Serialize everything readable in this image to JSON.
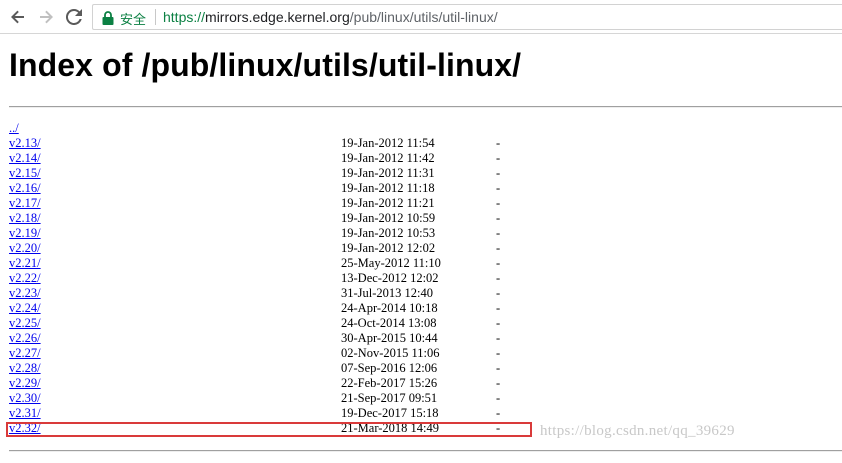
{
  "browser": {
    "security_label": "安全",
    "url_scheme": "https://",
    "url_host": "mirrors.edge.kernel.org",
    "url_path": "/pub/linux/utils/util-linux/"
  },
  "page": {
    "title": "Index of /pub/linux/utils/util-linux/"
  },
  "listing": {
    "parent": "../",
    "entries": [
      {
        "name": "v2.13/",
        "date": "19-Jan-2012 11:54",
        "size": "-"
      },
      {
        "name": "v2.14/",
        "date": "19-Jan-2012 11:42",
        "size": "-"
      },
      {
        "name": "v2.15/",
        "date": "19-Jan-2012 11:31",
        "size": "-"
      },
      {
        "name": "v2.16/",
        "date": "19-Jan-2012 11:18",
        "size": "-"
      },
      {
        "name": "v2.17/",
        "date": "19-Jan-2012 11:21",
        "size": "-"
      },
      {
        "name": "v2.18/",
        "date": "19-Jan-2012 10:59",
        "size": "-"
      },
      {
        "name": "v2.19/",
        "date": "19-Jan-2012 10:53",
        "size": "-"
      },
      {
        "name": "v2.20/",
        "date": "19-Jan-2012 12:02",
        "size": "-"
      },
      {
        "name": "v2.21/",
        "date": "25-May-2012 11:10",
        "size": "-"
      },
      {
        "name": "v2.22/",
        "date": "13-Dec-2012 12:02",
        "size": "-"
      },
      {
        "name": "v2.23/",
        "date": "31-Jul-2013 12:40",
        "size": "-"
      },
      {
        "name": "v2.24/",
        "date": "24-Apr-2014 10:18",
        "size": "-"
      },
      {
        "name": "v2.25/",
        "date": "24-Oct-2014 13:08",
        "size": "-"
      },
      {
        "name": "v2.26/",
        "date": "30-Apr-2015 10:44",
        "size": "-"
      },
      {
        "name": "v2.27/",
        "date": "02-Nov-2015 11:06",
        "size": "-"
      },
      {
        "name": "v2.28/",
        "date": "07-Sep-2016 12:06",
        "size": "-"
      },
      {
        "name": "v2.29/",
        "date": "22-Feb-2017 15:26",
        "size": "-"
      },
      {
        "name": "v2.30/",
        "date": "21-Sep-2017 09:51",
        "size": "-"
      },
      {
        "name": "v2.31/",
        "date": "19-Dec-2017 15:18",
        "size": "-"
      },
      {
        "name": "v2.32/",
        "date": "21-Mar-2018 14:49",
        "size": "-"
      }
    ]
  },
  "watermark": "https://blog.csdn.net/qq_39629",
  "colors": {
    "link": "#0000ee",
    "highlight": "#d93a3a",
    "secure": "#0b8043"
  },
  "icons": [
    "back-arrow-icon",
    "forward-arrow-icon",
    "reload-icon",
    "lock-icon"
  ]
}
